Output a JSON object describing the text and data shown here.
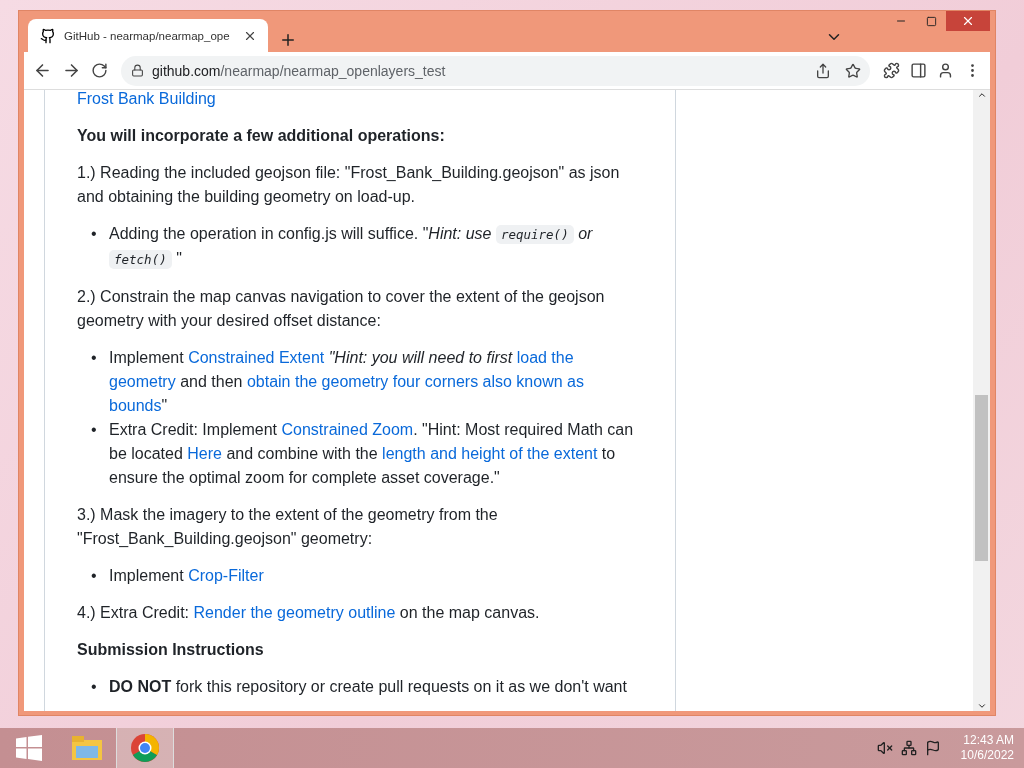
{
  "browser": {
    "tab": {
      "title": "GitHub - nearmap/nearmap_ope",
      "selected": true
    },
    "url": {
      "host": "github.com",
      "path": "/nearmap/nearmap_openlayers_test"
    }
  },
  "article": [
    {
      "kind": "paragraph",
      "segments": [
        {
          "kind": "link",
          "text": "Frost Bank Building"
        }
      ]
    },
    {
      "kind": "heading",
      "segments": [
        {
          "kind": "text",
          "text": "You will incorporate a few additional operations:"
        }
      ]
    },
    {
      "kind": "paragraph",
      "segments": [
        {
          "kind": "text",
          "text": "1.) Reading the included geojson file: \"Frost_Bank_Building.geojson\" as json and obtaining the building geometry on load-up."
        }
      ]
    },
    {
      "kind": "bullets",
      "marker": "•",
      "items": [
        [
          {
            "kind": "text",
            "text": "Adding the operation in config.js will suffice. \""
          },
          {
            "kind": "italic",
            "text": "Hint: use",
            "attach": true
          },
          {
            "kind": "code",
            "text": "require()"
          },
          {
            "kind": "italic",
            "text": "or"
          },
          {
            "kind": "code",
            "text": "fetch()"
          },
          {
            "kind": "text",
            "text": "\""
          }
        ]
      ]
    },
    {
      "kind": "paragraph",
      "segments": [
        {
          "kind": "text",
          "text": "2.) Constrain the map canvas navigation to cover the extent of the geojson geometry with your desired offset distance:"
        }
      ]
    },
    {
      "kind": "bullets",
      "marker": "•",
      "items": [
        [
          {
            "kind": "text",
            "text": "Implement"
          },
          {
            "kind": "link",
            "text": "Constrained Extent"
          },
          {
            "kind": "italic",
            "text": "\"Hint: you will need to first"
          },
          {
            "kind": "link",
            "text": "load the"
          },
          {
            "kind": "link",
            "text": "geometry"
          },
          {
            "kind": "text",
            "text": "and then"
          },
          {
            "kind": "link",
            "text": "obtain the geometry four corners also known as"
          },
          {
            "kind": "link",
            "text": "bounds"
          },
          {
            "kind": "text",
            "text": "\"",
            "attach": true
          }
        ],
        [
          {
            "kind": "text",
            "text": "Extra Credit: Implement"
          },
          {
            "kind": "link",
            "text": "Constrained Zoom"
          },
          {
            "kind": "text",
            "text": ". \"Hint: Most required Math can be located",
            "attach": true
          },
          {
            "kind": "link",
            "text": "Here"
          },
          {
            "kind": "text",
            "text": "and combine with the"
          },
          {
            "kind": "link",
            "text": "length and height of the extent"
          },
          {
            "kind": "text",
            "text": "to ensure the optimal zoom for complete asset coverage.\""
          }
        ]
      ]
    },
    {
      "kind": "paragraph",
      "segments": [
        {
          "kind": "text",
          "text": "3.) Mask the imagery to the extent of the geometry from the \"Frost_Bank_Building.geojson\" geometry:"
        }
      ]
    },
    {
      "kind": "bullets",
      "marker": "•",
      "items": [
        [
          {
            "kind": "text",
            "text": "Implement"
          },
          {
            "kind": "link",
            "text": "Crop-Filter"
          }
        ]
      ]
    },
    {
      "kind": "paragraph",
      "segments": [
        {
          "kind": "text",
          "text": "4.) Extra Credit:"
        },
        {
          "kind": "link",
          "text": "Render the geometry outline"
        },
        {
          "kind": "text",
          "text": "on the map canvas."
        }
      ]
    },
    {
      "kind": "heading",
      "segments": [
        {
          "kind": "text",
          "text": "Submission Instructions"
        }
      ]
    },
    {
      "kind": "bullets",
      "marker": "•",
      "items": [
        [
          {
            "kind": "bold",
            "text": "DO NOT"
          },
          {
            "kind": "text",
            "text": "fork this repository or create pull requests on it as we don't want"
          }
        ]
      ]
    }
  ],
  "taskbar": {
    "apps": [
      {
        "kind": "explorer",
        "selected": false
      },
      {
        "kind": "chrome",
        "selected": true
      }
    ],
    "clock": {
      "time": "12:43 AM",
      "date": "10/6/2022"
    }
  }
}
